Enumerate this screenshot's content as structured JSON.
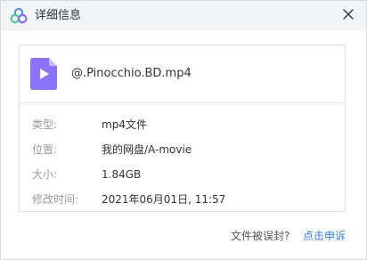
{
  "window": {
    "title": "详细信息",
    "logo_icon": "cloud-logo-icon",
    "close_icon": "close-icon"
  },
  "file": {
    "icon": "video-file-icon",
    "name": "@.Pinocchio.BD.mp4",
    "icon_color": "#8b73ff"
  },
  "details": [
    {
      "label": "类型:",
      "value": "mp4文件"
    },
    {
      "label": "位置:",
      "value": "我的网盘/A-movie"
    },
    {
      "label": "大小:",
      "value": "1.84GB"
    },
    {
      "label": "修改时间:",
      "value": "2021年06月01日, 11:57"
    }
  ],
  "footer": {
    "question": "文件被误封?",
    "appeal_link": "点击申诉"
  },
  "colors": {
    "link": "#2f7ff0",
    "titlebar": "#f2f4f7",
    "label": "#9a9a9a"
  }
}
